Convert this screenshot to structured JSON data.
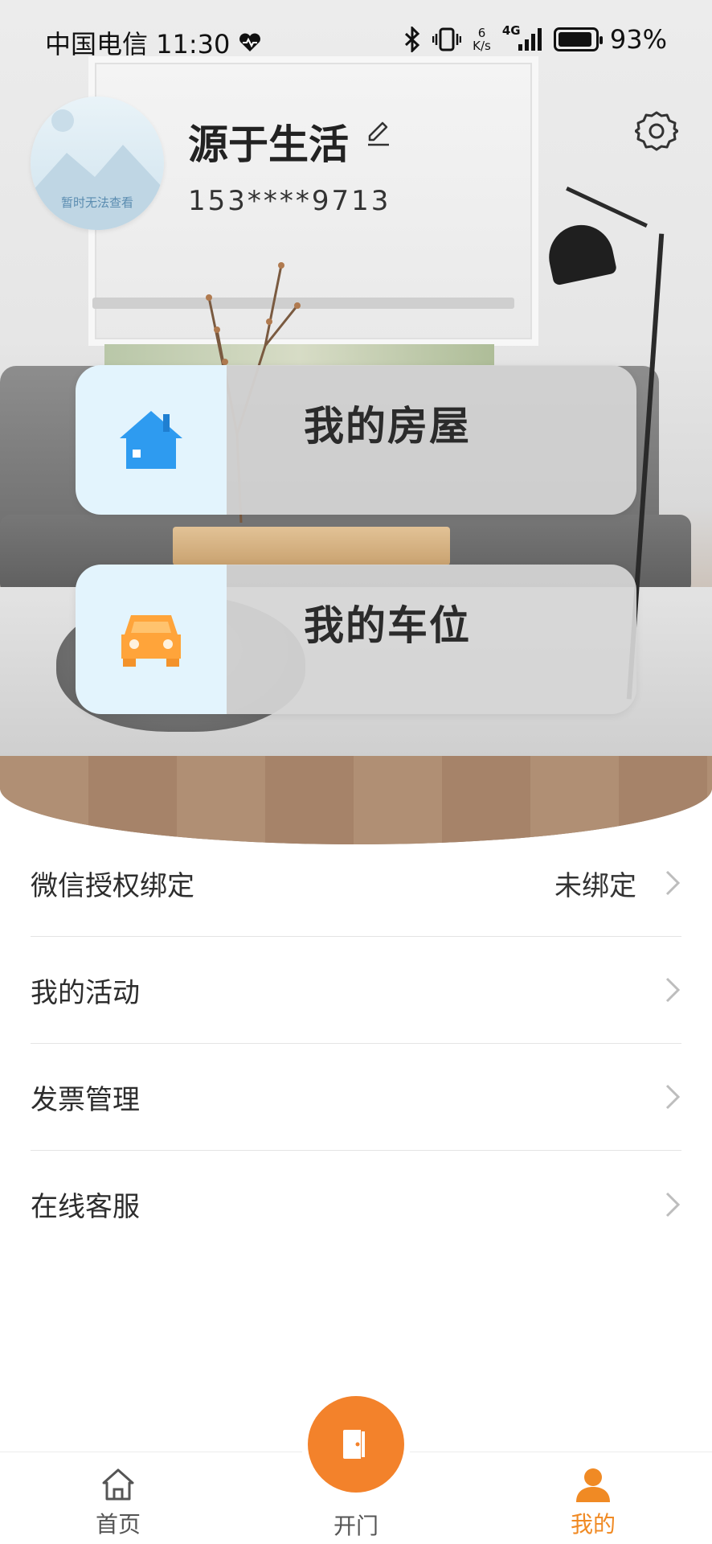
{
  "status_bar": {
    "carrier_time": "中国电信 11:30",
    "net_speed_value": "6",
    "net_speed_unit": "K/s",
    "signal_label": "4G",
    "battery": "93%",
    "battery_level": 0.93
  },
  "profile": {
    "avatar_text": "暂时无法查看",
    "username": "源于生活",
    "phone": "153****9713"
  },
  "cards": {
    "house_label": "我的房屋",
    "parking_label": "我的车位"
  },
  "menu": {
    "items": [
      {
        "label": "微信授权绑定",
        "value": "未绑定"
      },
      {
        "label": "我的活动",
        "value": ""
      },
      {
        "label": "发票管理",
        "value": ""
      },
      {
        "label": "在线客服",
        "value": ""
      }
    ]
  },
  "bottom_nav": {
    "home_label": "首页",
    "open_label": "开门",
    "mine_label": "我的"
  },
  "colors": {
    "accent": "#f3822b",
    "active_tab": "#f08a24",
    "house_icon": "#2e9bf0",
    "parking_icon": "#ffa43a"
  },
  "icons": [
    "settings-icon",
    "edit-icon",
    "house-icon",
    "car-icon",
    "chevron-right-icon",
    "home-icon",
    "door-icon",
    "person-icon"
  ]
}
